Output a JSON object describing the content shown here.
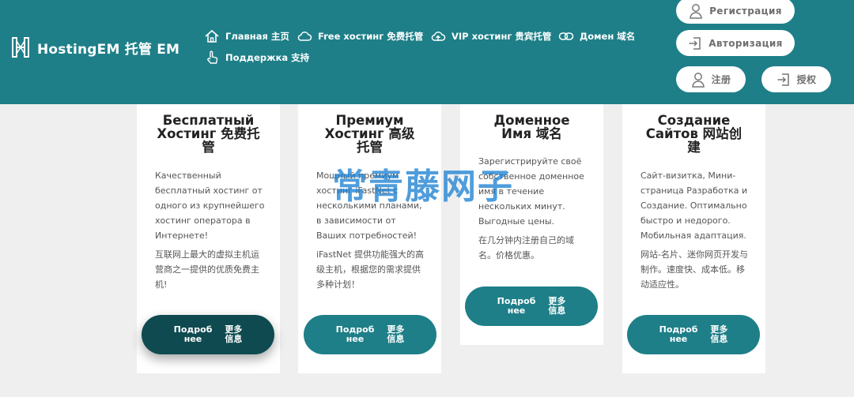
{
  "brand": {
    "name": "HostingEM 托管 EM",
    "icon": "hosting-logo-icon"
  },
  "colors": {
    "header": "#1e7f88",
    "button": "#1e7f88",
    "button_active": "#0f4a50",
    "page_bg": "#efefef"
  },
  "nav": [
    {
      "label": "Главная 主页",
      "icon": "home-icon"
    },
    {
      "label": "Free хостинг 免费托管",
      "icon": "cloud-icon"
    },
    {
      "label": "VIP хостинг 贵宾托管",
      "icon": "cloud-upload-icon"
    },
    {
      "label": "Домен 域名",
      "icon": "link-icon"
    },
    {
      "label": "Поддержка 支持",
      "icon": "hand-pointer-icon"
    }
  ],
  "auth": {
    "register_ru": "Регистрация",
    "login_ru": "Авторизация",
    "register_zh": "注册",
    "login_zh": "授权"
  },
  "cards": [
    {
      "title": [
        "Бесплатный",
        "Хостинг 免费托",
        "管"
      ],
      "text_ru": "Качественный бесплатный хостинг от одного из крупнейшего хостинг оператора в Интернете!",
      "text_zh": "互联网上最大的虚拟主机运营商之一提供的优质免费主机!",
      "button": [
        "Подроб",
        "нее",
        "更多",
        "信息"
      ]
    },
    {
      "title": [
        "Премиум",
        "Хостинг 高级",
        "托管"
      ],
      "text_ru": "Мощный премиум хостинг iFastNet с несколькими планами, в зависимости от Ваших потребностей!",
      "text_zh": "iFastNet 提供功能强大的高级主机，根据您的需求提供多种计划！",
      "button": [
        "Подроб",
        "нее",
        "更多",
        "信息"
      ]
    },
    {
      "title": [
        "Доменное",
        "Имя 域名"
      ],
      "text_ru": "Зарегистрируйте своё собственное доменное имя в течение нескольких минут. Выгодные цены.",
      "text_zh": "在几分钟内注册自己的域名。价格优惠。",
      "button": [
        "Подроб",
        "нее",
        "更多",
        "信息"
      ]
    },
    {
      "title": [
        "Создание",
        "Сайтов 网站创",
        "建"
      ],
      "text_ru": "Сайт-визитка, Мини-страница Разработка и Создание. Оптимально быстро и недорого. Мобильная адаптация.",
      "text_zh": "网站-名片、迷你网页开发与制作。速度快、成本低。移动适应性。",
      "button": [
        "Подроб",
        "нее",
        "更多",
        "信息"
      ]
    }
  ],
  "watermark": "常青藤网子"
}
